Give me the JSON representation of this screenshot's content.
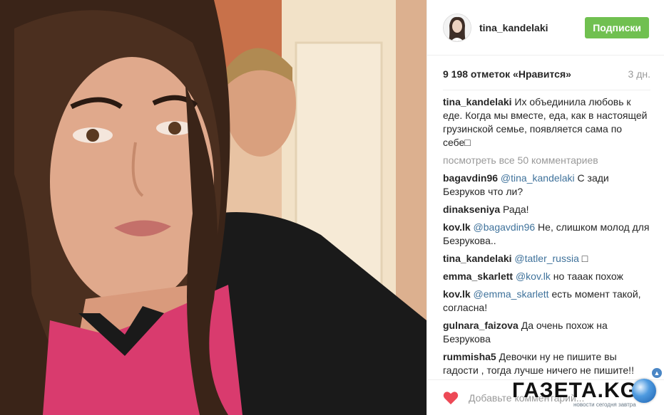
{
  "header": {
    "username": "tina_kandelaki",
    "follow_label": "Подписки"
  },
  "stats": {
    "likes": "9 198 отметок «Нравится»",
    "age": "3 дн."
  },
  "caption": {
    "user": "tina_kandelaki",
    "text": " Их объединила любовь к еде. Когда мы вместе, еда, как в настоящей грузинской семье, появляется сама по себе□"
  },
  "view_all": "посмотреть все 50 комментариев",
  "comments": [
    {
      "user": "bagavdin96",
      "mention": "@tina_kandelaki",
      "text": " С зади Безруков что ли?"
    },
    {
      "user": "dinakseniya",
      "mention": "",
      "text": " Рада!"
    },
    {
      "user": "kov.lk",
      "mention": "@bagavdin96",
      "text": " Не, слишком молод для Безрукова.."
    },
    {
      "user": "tina_kandelaki",
      "mention": "@tatler_russia",
      "text": " □"
    },
    {
      "user": "emma_skarlett",
      "mention": "@kov.lk",
      "text": " но тааак похож"
    },
    {
      "user": "kov.lk",
      "mention": "@emma_skarlett",
      "text": " есть момент такой, согласна!"
    },
    {
      "user": "gulnara_faizova",
      "mention": "",
      "text": " Да очень похож на Безрукова"
    },
    {
      "user": "rummisha5",
      "mention": "",
      "text": " Девочки ну не пишите вы гадости , тогда лучше ничего не пишите!!"
    }
  ],
  "bottom": {
    "add_comment_placeholder": "Добавьте комментарий..."
  },
  "watermark": {
    "brand": "ГАЗЕТА.KG",
    "tagline": "новости сегодня завтра"
  },
  "colors": {
    "follow_button": "#70c050",
    "mention": "#3f729b",
    "heart": "#ed4956"
  }
}
